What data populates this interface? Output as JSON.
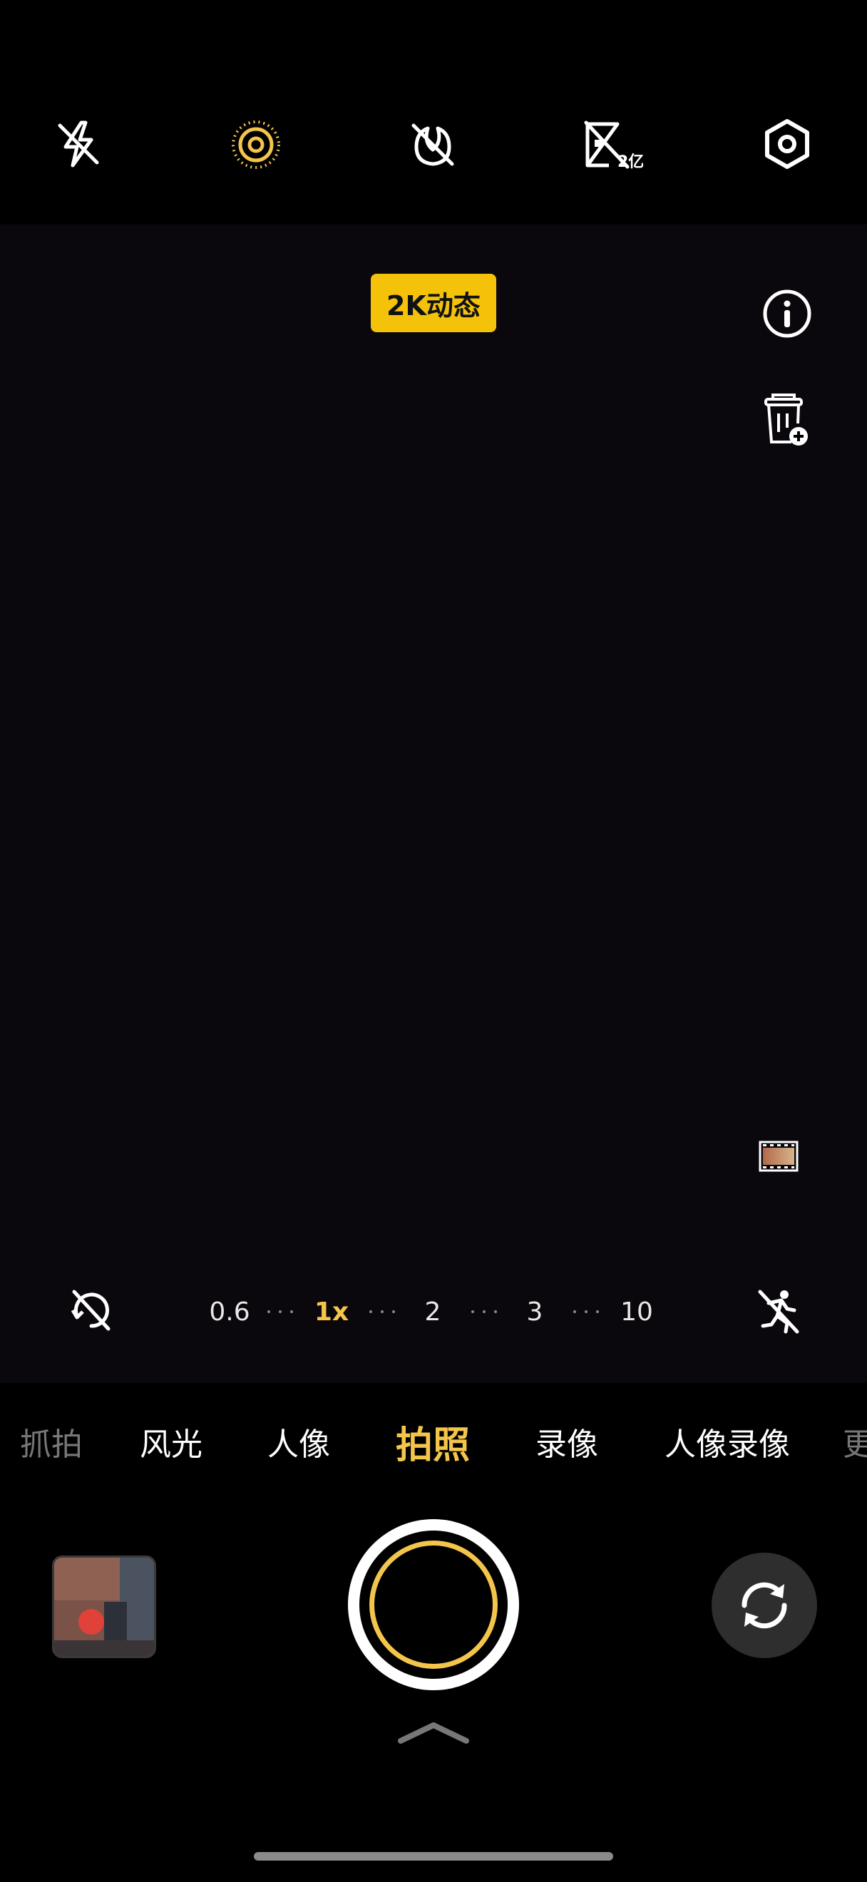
{
  "top_toolbar": {
    "icons": [
      "flash-off-icon",
      "live-photo-icon",
      "ai-off-icon",
      "high-res-200mp-icon",
      "settings-icon"
    ],
    "high_res_label": "2亿",
    "accent_color": "#f3c54b"
  },
  "viewfinder": {
    "badge": "2K动态",
    "side_icons": [
      "info-icon",
      "watermark-add-icon",
      "filter-preview-icon"
    ]
  },
  "zoom": {
    "levels": [
      "0.6",
      "1x",
      "2",
      "3",
      "10"
    ],
    "active": "1x"
  },
  "modes": {
    "items": [
      "抓拍",
      "风光",
      "人像",
      "拍照",
      "录像",
      "人像录像",
      "更"
    ],
    "active": "拍照"
  },
  "controls": {
    "gallery": "gallery-thumbnail",
    "shutter": "shutter-button",
    "switch_camera": "switch-camera-icon",
    "expand": "chevron-up-icon"
  }
}
